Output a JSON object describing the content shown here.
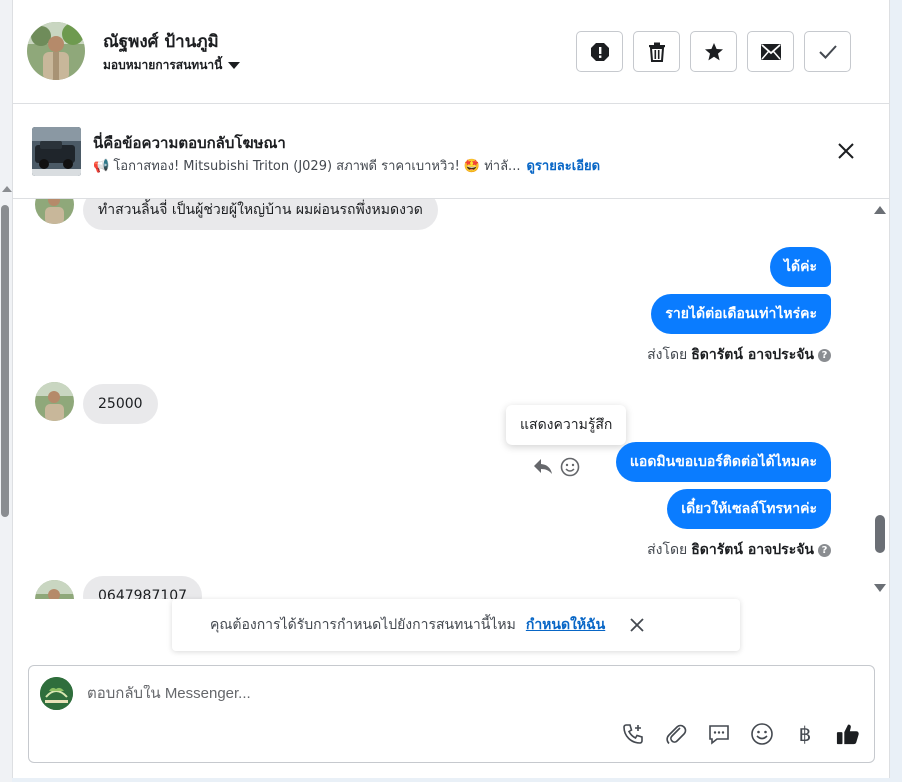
{
  "header": {
    "contact_name": "ณัฐพงศ์ ป้านภูมิ",
    "assign_label": "มอบหมายการสนทนานี้",
    "actions": [
      "spam-icon",
      "trash-icon",
      "star-icon",
      "mail-icon",
      "check-icon"
    ]
  },
  "ad": {
    "title": "นี่คือข้อความตอบกลับโฆษณา",
    "subtitle": "📢 โอกาสทอง! Mitsubishi Triton (J029) สภาพดี ราคาเบาหวิว! 🤩 ท่าลั...",
    "link": "ดูรายละเอียด"
  },
  "messages": {
    "incoming_1": "ทำสวนลิ้นจี่  เป็นผู้ช่วยผู้ใหญ่บ้าน ผมผ่อนรถพึ่งหมดงวด",
    "outgoing_1": "ได้ค่ะ",
    "outgoing_2": "รายได้ต่อเดือนเท่าไหร่คะ",
    "sent_by_prefix": "ส่งโดย",
    "sent_by_name": "ธิดารัตน์ อาจประจัน",
    "incoming_2": "25000",
    "tooltip": "แสดงความรู้สึก",
    "outgoing_3": "แอดมินขอเบอร์ติดต่อได้ไหมคะ",
    "outgoing_4": "เดี๋ยวให้เซลล์โทรหาค่ะ",
    "incoming_3": "0647987107"
  },
  "assign_prompt": {
    "text": "คุณต้องการได้รับการกำหนดไปยังการสนทนานี้ไหม",
    "link": "กำหนดให้ฉัน"
  },
  "composer": {
    "placeholder": "ตอบกลับใน Messenger...",
    "baht_symbol": "฿",
    "tools": [
      "phone-plus-icon",
      "paperclip-icon",
      "chat-bubble-icon",
      "emoji-icon",
      "baht-icon",
      "thumbs-up-icon"
    ]
  },
  "colors": {
    "accent": "#0a7cff",
    "link": "#0866c6",
    "incoming_bubble": "#e9e9eb"
  }
}
